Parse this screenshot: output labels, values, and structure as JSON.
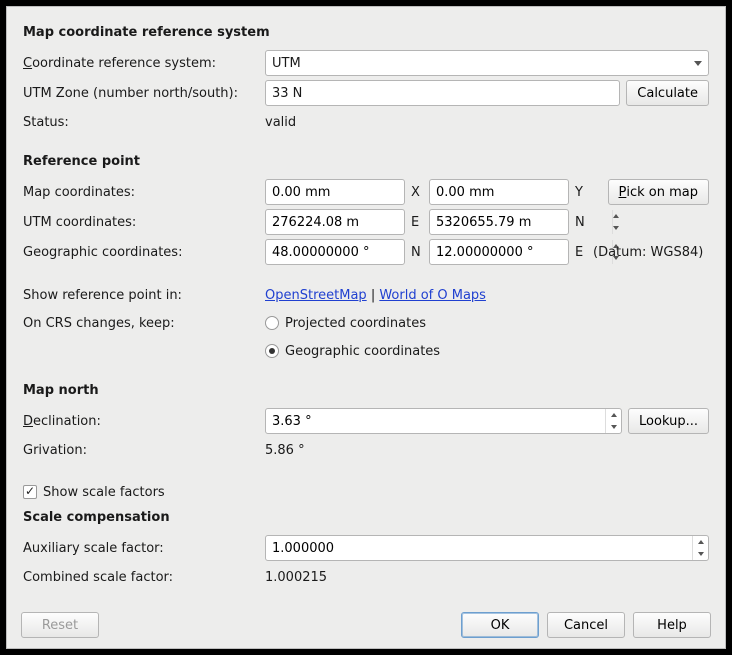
{
  "crs": {
    "heading": "Map coordinate reference system",
    "crs_label": "Coordinate reference system:",
    "crs_value": "UTM",
    "zone_label": "UTM Zone (number north/south):",
    "zone_value": "33 N",
    "calculate": "Calculate",
    "status_label": "Status:",
    "status_value": "valid"
  },
  "refpoint": {
    "heading": "Reference point",
    "mapcoord_label": "Map coordinates:",
    "mapcoord_x": "0.00 mm",
    "mapcoord_y": "0.00 mm",
    "x": "X",
    "y": "Y",
    "pick": "Pick on map",
    "utmcoord_label": "UTM coordinates:",
    "utm_e": "276224.08 m",
    "utm_n": "5320655.79 m",
    "e": "E",
    "n": "N",
    "geocoord_label": "Geographic coordinates:",
    "geo_lat": "48.00000000 °",
    "geo_lon": "12.00000000 °",
    "datum": "(Datum: WGS84)",
    "showin_label": "Show reference point in:",
    "osm": "OpenStreetMap",
    "sep": " | ",
    "woo": "World of O Maps",
    "onchange_label": "On CRS changes, keep:",
    "opt_projected": "Projected coordinates",
    "opt_geographic": "Geographic coordinates"
  },
  "mapnorth": {
    "heading": "Map north",
    "decl_label": "Declination:",
    "decl_value": "3.63 °",
    "lookup": "Lookup...",
    "griv_label": "Grivation:",
    "griv_value": "5.86 °"
  },
  "scale": {
    "show_factors": "Show scale factors",
    "heading": "Scale compensation",
    "aux_label": "Auxiliary scale factor:",
    "aux_value": "1.000000",
    "combined_label": "Combined scale factor:",
    "combined_value": "1.000215"
  },
  "footer": {
    "reset": "Reset",
    "ok": "OK",
    "cancel": "Cancel",
    "help": "Help"
  }
}
